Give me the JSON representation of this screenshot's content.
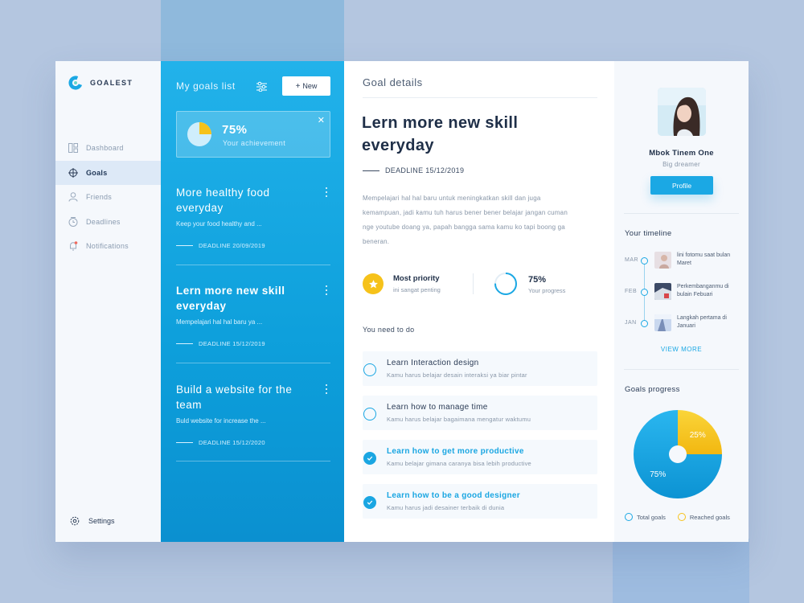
{
  "app": {
    "name": "GOALEST"
  },
  "sidebar": {
    "items": [
      {
        "label": "Dashboard",
        "icon": "dashboard-icon",
        "active": false
      },
      {
        "label": "Goals",
        "icon": "target-icon",
        "active": true
      },
      {
        "label": "Friends",
        "icon": "user-icon",
        "active": false
      },
      {
        "label": "Deadlines",
        "icon": "clock-icon",
        "active": false
      },
      {
        "label": "Notifications",
        "icon": "bell-icon",
        "active": false
      }
    ],
    "settings_label": "Settings"
  },
  "goals_list": {
    "title": "My goals list",
    "new_button": "New",
    "achievement": {
      "value": "75%",
      "label": "Your achievement",
      "fraction": 0.75
    },
    "goals": [
      {
        "title": "More healthy food everyday",
        "desc": "Keep your food healthy and ...",
        "deadline": "DEADLINE 20/09/2019",
        "active": false
      },
      {
        "title": "Lern more new skill everyday",
        "desc": "Mempelajari hal hal baru ya ...",
        "deadline": "DEADLINE 15/12/2019",
        "active": true
      },
      {
        "title": "Build a website for the team",
        "desc": "Buld website for increase the ...",
        "deadline": "DEADLINE 15/12/2020",
        "active": false
      }
    ]
  },
  "details": {
    "header": "Goal details",
    "title": "Lern more new skill everyday",
    "deadline": "DEADLINE 15/12/2019",
    "description": "Mempelajari hal hal baru untuk meningkatkan skill dan juga kemampuan, jadi kamu tuh harus bener bener belajar jangan cuman nge youtube doang ya, papah bangga sama kamu ko tapi boong ga beneran.",
    "priority": {
      "title": "Most priority",
      "sub": "ini sangat penting"
    },
    "progress": {
      "value": "75%",
      "sub": "Your progress",
      "fraction": 0.75
    },
    "todo_heading": "You need to do",
    "todos": [
      {
        "title": "Learn Interaction design",
        "sub": "Kamu harus belajar desain interaksi ya biar pintar",
        "done": false
      },
      {
        "title": "Learn how to manage time",
        "sub": "Kamu harus belajar bagaimana mengatur waktumu",
        "done": false
      },
      {
        "title": "Learn how to get more productive",
        "sub": "Kamu belajar gimana caranya bisa lebih productive",
        "done": true
      },
      {
        "title": "Learn how to be a good designer",
        "sub": "Kamu harus jadi desainer terbaik di dunia",
        "done": true
      }
    ]
  },
  "profile": {
    "name": "Mbok Tinem One",
    "role": "Big dreamer",
    "button": "Profile"
  },
  "timeline": {
    "title": "Your timeline",
    "items": [
      {
        "month": "MAR",
        "text": "lini fotomu saat bulan Maret"
      },
      {
        "month": "FEB",
        "text": "Perkembanganmu di bulain Febuari"
      },
      {
        "month": "JAN",
        "text": "Langkah pertama di Januari"
      }
    ],
    "view_more": "VIEW MORE"
  },
  "goals_progress": {
    "title": "Goals progress",
    "legend": {
      "total": "Total goals",
      "reached": "Reached goals"
    }
  },
  "colors": {
    "accent": "#1ba8e4",
    "yellow": "#f6c21a",
    "dark": "#1f2f48"
  },
  "chart_data": {
    "type": "pie",
    "categories": [
      "Total goals",
      "Reached goals"
    ],
    "values": [
      75,
      25
    ],
    "labels": [
      "75%",
      "25%"
    ],
    "colors": [
      "#1ba8e4",
      "#f6c21a"
    ]
  }
}
